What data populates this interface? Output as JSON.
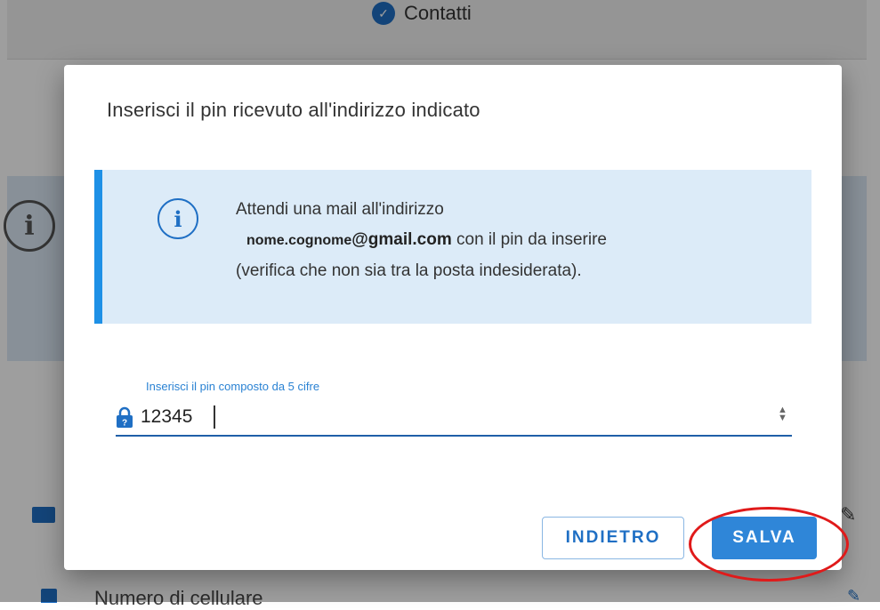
{
  "background": {
    "step_label": "Contatti",
    "step_icon": "check-icon",
    "mobile_label": "Numero di cellulare"
  },
  "dialog": {
    "title": "Inserisci il pin ricevuto all'indirizzo indicato",
    "info": {
      "icon": "info-icon",
      "line1": "Attendi una mail all'indirizzo",
      "email_user": "nome.cognome",
      "email_domain": "@gmail.com",
      "line2_suffix": " con il pin da inserire",
      "line3": "(verifica che non sia tra la posta indesiderata)."
    },
    "pin_field": {
      "label": "Inserisci il pin composto da 5 cifre",
      "value": "12345"
    },
    "buttons": {
      "back": "INDIETRO",
      "save": "SALVA"
    }
  },
  "colors": {
    "accent": "#2f86d8",
    "info_bg": "#dcebf8",
    "highlight": "#e01a1a"
  }
}
